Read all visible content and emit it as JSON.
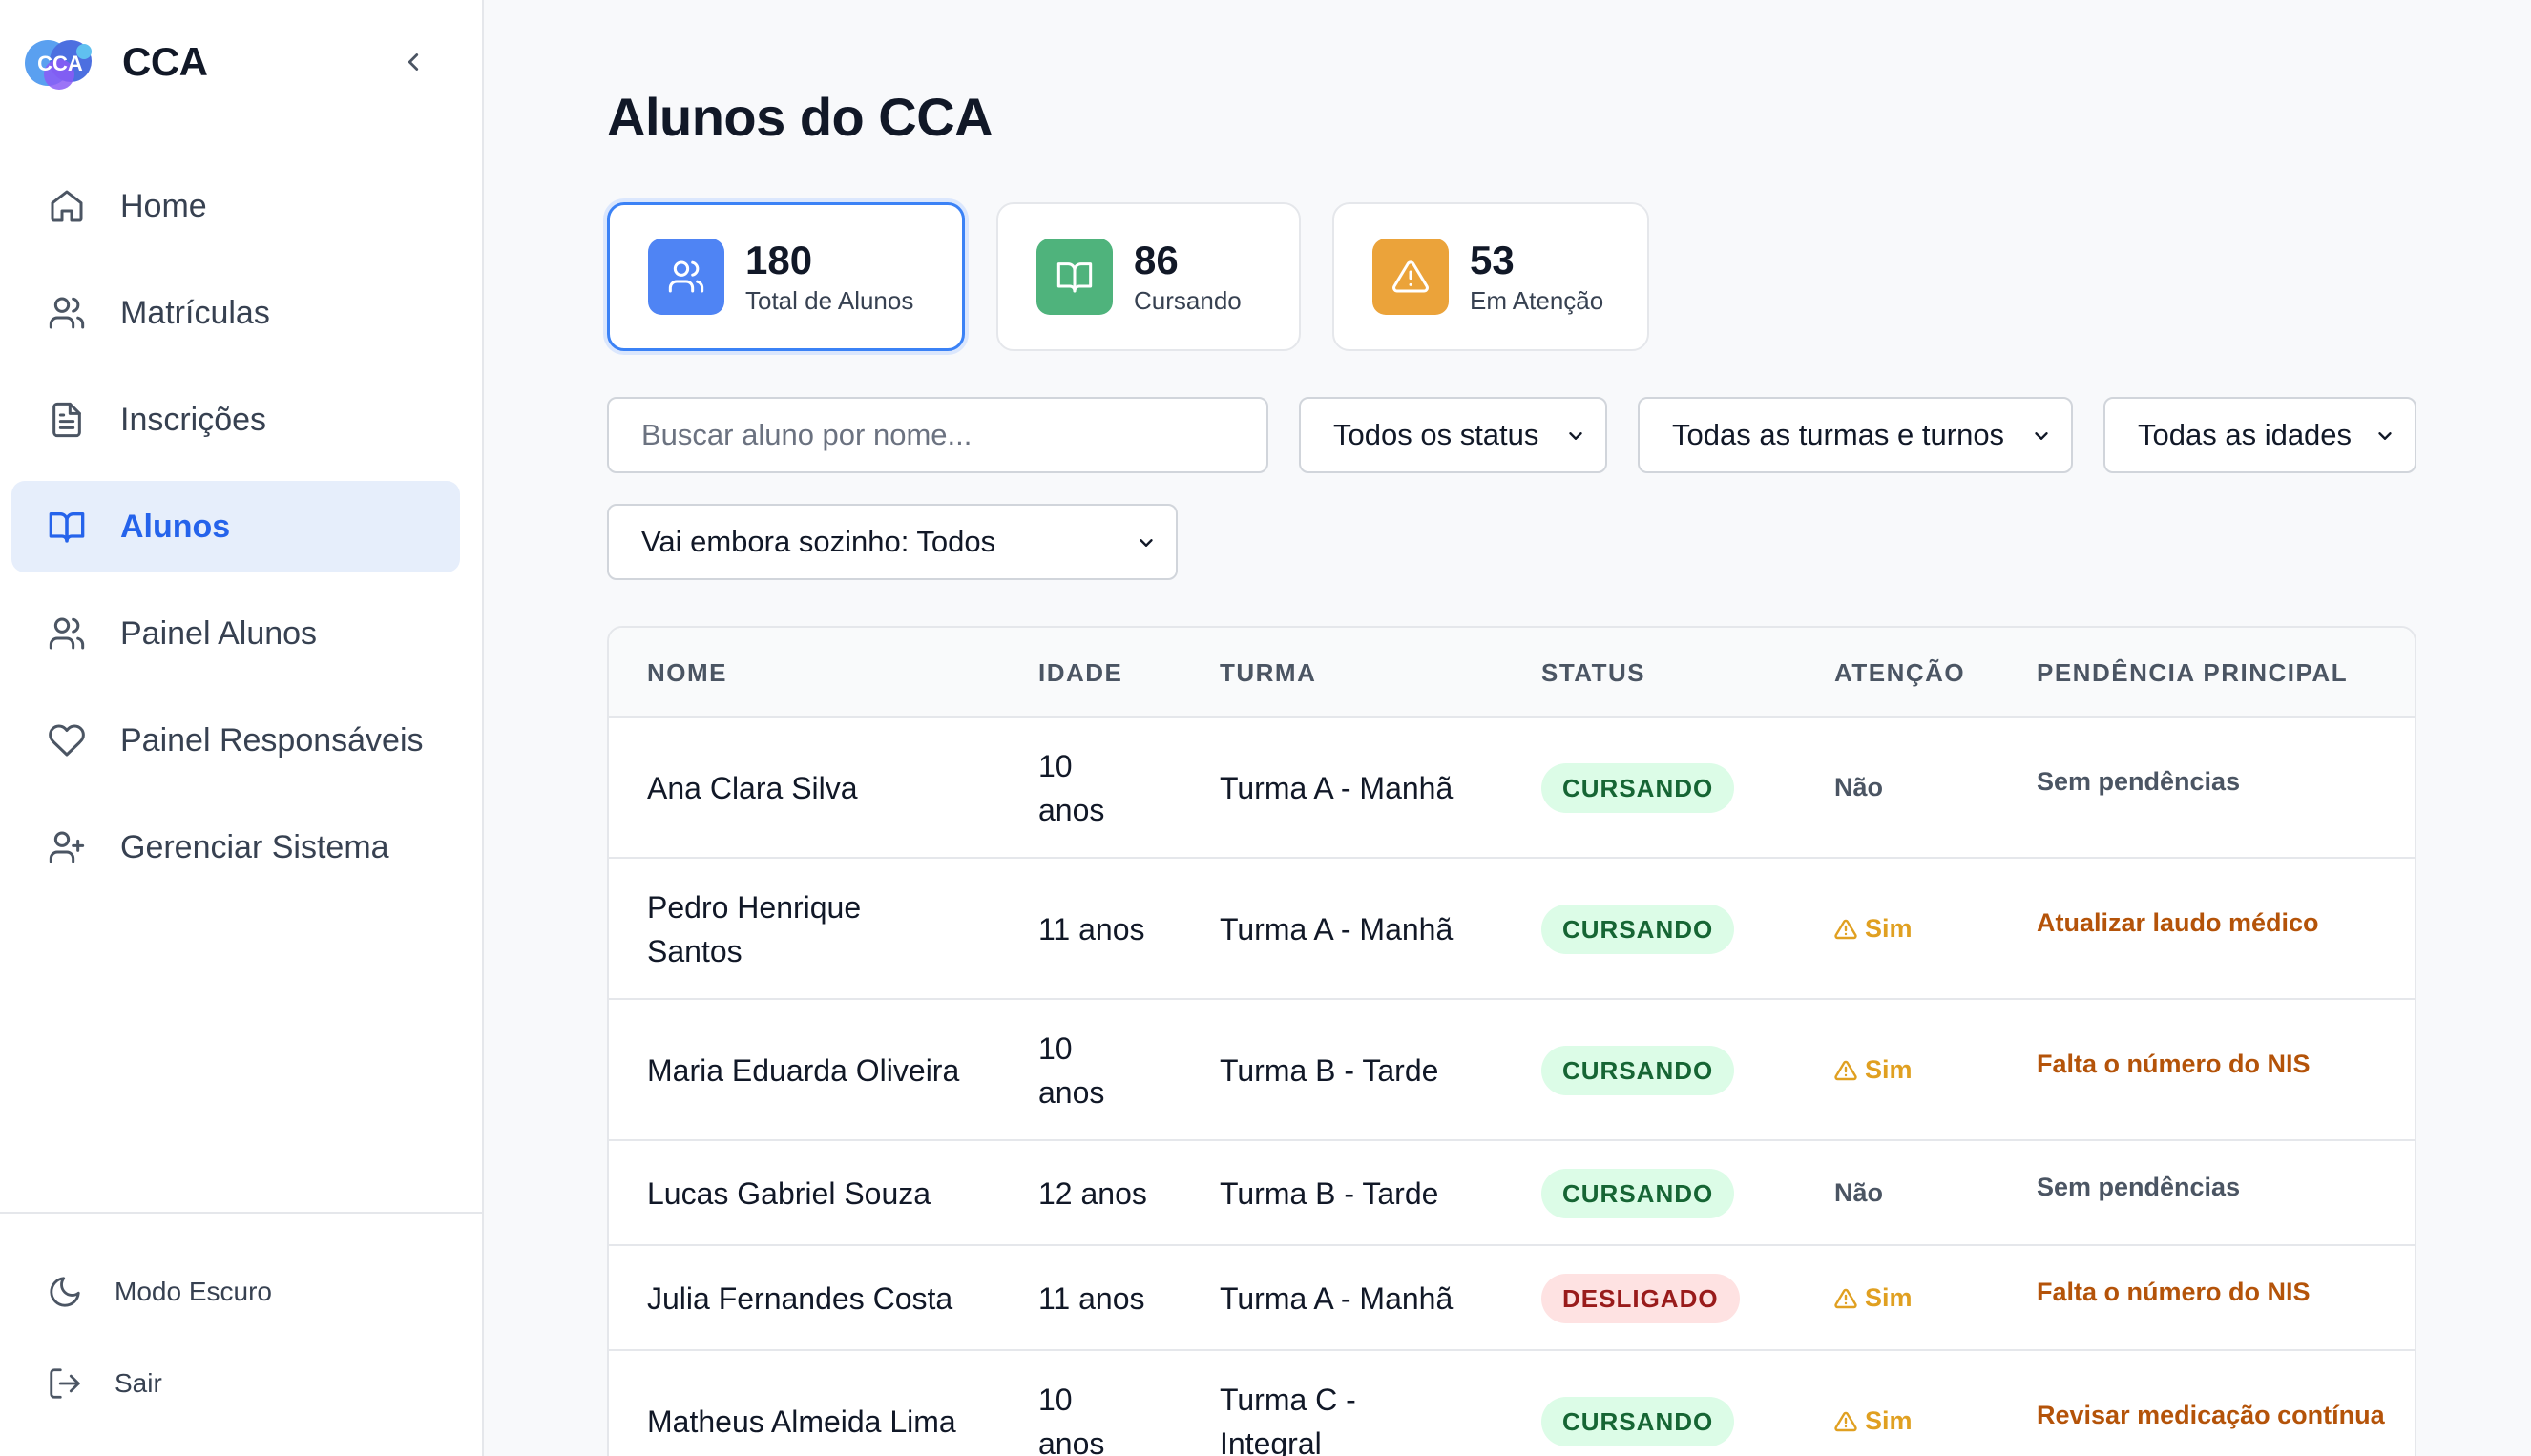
{
  "app": {
    "name": "CCA"
  },
  "nav": [
    {
      "label": "Home",
      "icon": "home-icon",
      "active": false
    },
    {
      "label": "Matrículas",
      "icon": "users-icon",
      "active": false
    },
    {
      "label": "Inscrições",
      "icon": "file-text-icon",
      "active": false
    },
    {
      "label": "Alunos",
      "icon": "book-open-icon",
      "active": true
    },
    {
      "label": "Painel Alunos",
      "icon": "users-icon",
      "active": false
    },
    {
      "label": "Painel Responsáveis",
      "icon": "heart-icon",
      "active": false
    },
    {
      "label": "Gerenciar Sistema",
      "icon": "user-plus-icon",
      "active": false
    }
  ],
  "bottom_nav": {
    "dark_mode_label": "Modo Escuro",
    "logout_label": "Sair"
  },
  "page": {
    "title": "Alunos do CCA"
  },
  "stats": [
    {
      "value": "180",
      "label": "Total de Alunos",
      "icon": "users-icon",
      "color": "#4f84f4"
    },
    {
      "value": "86",
      "label": "Cursando",
      "icon": "book-open-icon",
      "color": "#4fb37c"
    },
    {
      "value": "53",
      "label": "Em Atenção",
      "icon": "alert-triangle-icon",
      "color": "#eba33a"
    }
  ],
  "filters": {
    "search_placeholder": "Buscar aluno por nome...",
    "status": "Todos os status",
    "turma": "Todas as turmas e turnos",
    "idade": "Todas as idades",
    "sozinho": "Vai embora sozinho: Todos"
  },
  "table": {
    "headers": [
      "NOME",
      "IDADE",
      "TURMA",
      "STATUS",
      "ATENÇÃO",
      "PENDÊNCIA PRINCIPAL"
    ],
    "rows": [
      {
        "nome": [
          "Ana Clara Silva"
        ],
        "idade": [
          "10",
          "anos"
        ],
        "turma": [
          "Turma A - Manhã"
        ],
        "status": "CURSANDO",
        "status_color": "green",
        "atencao": "Não",
        "atencao_flag": false,
        "pendencia": "Sem pendências",
        "pend_flag": false
      },
      {
        "nome": [
          "Pedro Henrique",
          "Santos"
        ],
        "idade": [
          "11 anos"
        ],
        "turma": [
          "Turma A - Manhã"
        ],
        "status": "CURSANDO",
        "status_color": "green",
        "atencao": "Sim",
        "atencao_flag": true,
        "pendencia": "Atualizar laudo médico",
        "pend_flag": true
      },
      {
        "nome": [
          "Maria Eduarda Oliveira"
        ],
        "idade": [
          "10",
          "anos"
        ],
        "turma": [
          "Turma B - Tarde"
        ],
        "status": "CURSANDO",
        "status_color": "green",
        "atencao": "Sim",
        "atencao_flag": true,
        "pendencia": "Falta o número do NIS",
        "pend_flag": true
      },
      {
        "nome": [
          "Lucas Gabriel Souza"
        ],
        "idade": [
          "12 anos"
        ],
        "turma": [
          "Turma B - Tarde"
        ],
        "status": "CURSANDO",
        "status_color": "green",
        "atencao": "Não",
        "atencao_flag": false,
        "pendencia": "Sem pendências",
        "pend_flag": false
      },
      {
        "nome": [
          "Julia Fernandes Costa"
        ],
        "idade": [
          "11 anos"
        ],
        "turma": [
          "Turma A - Manhã"
        ],
        "status": "DESLIGADO",
        "status_color": "red",
        "atencao": "Sim",
        "atencao_flag": true,
        "pendencia": "Falta o número do NIS",
        "pend_flag": true
      },
      {
        "nome": [
          "Matheus Almeida Lima"
        ],
        "idade": [
          "10",
          "anos"
        ],
        "turma": [
          "Turma C -",
          "Integral"
        ],
        "status": "CURSANDO",
        "status_color": "green",
        "atencao": "Sim",
        "atencao_flag": true,
        "pendencia": "Revisar medicação contínua",
        "pend_flag": true
      }
    ]
  }
}
